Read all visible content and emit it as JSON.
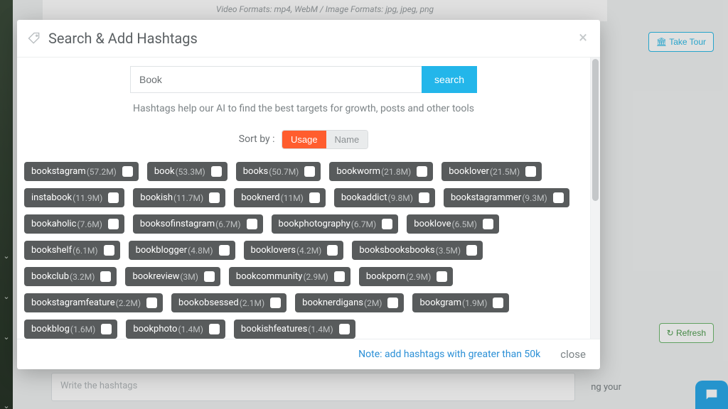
{
  "bg": {
    "formats": "Video Formats: mp4, WebM / Image Formats: jpg, jpeg, png",
    "take_tour": "Take Tour",
    "refresh": "Refresh",
    "hashtag_placeholder": "Write the hashtags",
    "caption_tail": "ng your"
  },
  "modal": {
    "title": "Search & Add Hashtags",
    "search_value": "Book",
    "search_label": "search",
    "help": "Hashtags help our AI to find the best targets for growth, posts and other tools",
    "sort_label": "Sort by :",
    "sort_usage": "Usage",
    "sort_name": "Name",
    "note": "Note: add hashtags with greater than 50k",
    "close": "close"
  },
  "hashtags": [
    {
      "tag": "bookstagram",
      "count": "57.2M"
    },
    {
      "tag": "book",
      "count": "53.3M"
    },
    {
      "tag": "books",
      "count": "50.7M"
    },
    {
      "tag": "bookworm",
      "count": "21.8M"
    },
    {
      "tag": "booklover",
      "count": "21.5M"
    },
    {
      "tag": "instabook",
      "count": "11.9M"
    },
    {
      "tag": "bookish",
      "count": "11.7M"
    },
    {
      "tag": "booknerd",
      "count": "11M"
    },
    {
      "tag": "bookaddict",
      "count": "9.8M"
    },
    {
      "tag": "bookstagrammer",
      "count": "9.3M"
    },
    {
      "tag": "bookaholic",
      "count": "7.6M"
    },
    {
      "tag": "booksofinstagram",
      "count": "6.7M"
    },
    {
      "tag": "bookphotography",
      "count": "6.7M"
    },
    {
      "tag": "booklove",
      "count": "6.5M"
    },
    {
      "tag": "bookshelf",
      "count": "6.1M"
    },
    {
      "tag": "bookblogger",
      "count": "4.8M"
    },
    {
      "tag": "booklovers",
      "count": "4.2M"
    },
    {
      "tag": "booksbooksbooks",
      "count": "3.5M"
    },
    {
      "tag": "bookclub",
      "count": "3.2M"
    },
    {
      "tag": "bookreview",
      "count": "3M"
    },
    {
      "tag": "bookcommunity",
      "count": "2.9M"
    },
    {
      "tag": "bookporn",
      "count": "2.9M"
    },
    {
      "tag": "bookstagramfeature",
      "count": "2.2M"
    },
    {
      "tag": "bookobsessed",
      "count": "2.1M"
    },
    {
      "tag": "booknerdigans",
      "count": "2M"
    },
    {
      "tag": "bookgram",
      "count": "1.9M"
    },
    {
      "tag": "bookblog",
      "count": "1.6M"
    },
    {
      "tag": "bookphoto",
      "count": "1.4M"
    },
    {
      "tag": "bookishfeatures",
      "count": "1.4M"
    }
  ]
}
